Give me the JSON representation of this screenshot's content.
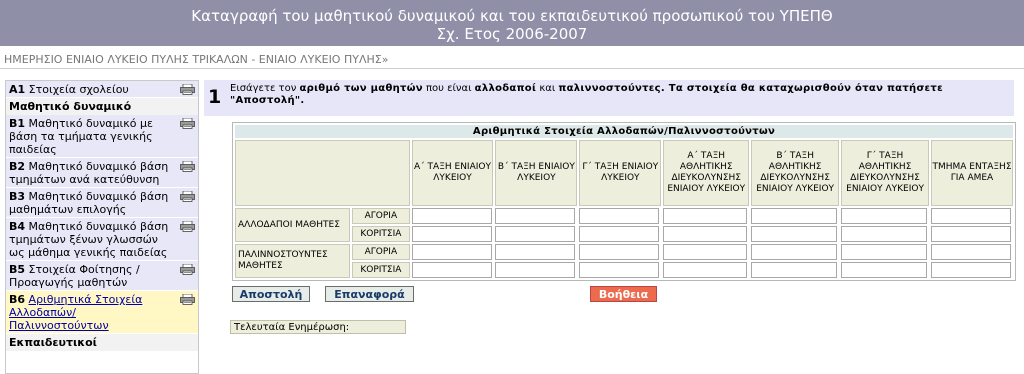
{
  "header": {
    "title_line1": "Καταγραφή του μαθητικού δυναμικού και του εκπαιδευτικού προσωπικού του ΥΠΕΠΘ",
    "title_line2": "Σχ. Ετος 2006-2007"
  },
  "breadcrumb": "ΗΜΕΡΗΣΙΟ ΕΝΙΑΙΟ ΛΥΚΕΙΟ ΠΥΛΗΣ ΤΡΙΚΑΛΩΝ - ΕΝΙΑΙΟ ΛΥΚΕΙΟ ΠΥΛΗΣ»",
  "sidebar": {
    "items": [
      {
        "num": "A1",
        "label": "Στοιχεία σχολείου"
      },
      {
        "section": "Μαθητικό δυναμικό"
      },
      {
        "num": "B1",
        "label": "Μαθητικό δυναμικό με βάση τα τμήματα γενικής παιδείας"
      },
      {
        "num": "B2",
        "label": "Μαθητικό δυναμικό βάση τμημάτων ανά κατεύθυνση"
      },
      {
        "num": "B3",
        "label": "Μαθητικό δυναμικό βάση μαθημάτων επιλογής"
      },
      {
        "num": "B4",
        "label": "Μαθητικό δυναμικό βάση τμημάτων ξένων γλωσσών ως μάθημα γενικής παιδείας"
      },
      {
        "num": "B5",
        "label": "Στοιχεία Φοίτησης / Προαγωγής μαθητών"
      },
      {
        "num": "B6",
        "label": "Αριθμητικά Στοιχεία Αλλοδαπών/ Παλιννοστούντων"
      },
      {
        "section": "Εκπαιδευτικοί"
      }
    ]
  },
  "instructions": {
    "step": "1",
    "text_1": "Εισάγετε τον ",
    "bold_1": "αριθμό των μαθητών",
    "text_2": " που είναι ",
    "bold_2": "αλλοδαποί",
    "text_3": " και ",
    "bold_3": "παλιννοστούντες. Τα στοιχεία θα καταχωρισθούν όταν πατήσετε \"Αποστολή\"."
  },
  "table": {
    "caption": "Αριθμητικά Στοιχεία Αλλοδαπών/Παλιννοστούντων",
    "columns": [
      "Α΄ ΤΑΞΗ ΕΝΙΑΙΟΥ ΛΥΚΕΙΟΥ",
      "Β΄ ΤΑΞΗ ΕΝΙΑΙΟΥ ΛΥΚΕΙΟΥ",
      "Γ΄ ΤΑΞΗ ΕΝΙΑΙΟΥ ΛΥΚΕΙΟΥ",
      "Α΄ ΤΑΞΗ ΑΘΛΗΤΙΚΗΣ ΔΙΕΥΚΟΛΥΝΣΗΣ ΕΝΙΑΙΟΥ ΛΥΚΕΙΟΥ",
      "Β΄ ΤΑΞΗ ΑΘΛΗΤΙΚΗΣ ΔΙΕΥΚΟΛΥΝΣΗΣ ΕΝΙΑΙΟΥ ΛΥΚΕΙΟΥ",
      "Γ΄ ΤΑΞΗ ΑΘΛΗΤΙΚΗΣ ΔΙΕΥΚΟΛΥΝΣΗΣ ΕΝΙΑΙΟΥ ΛΥΚΕΙΟΥ",
      "ΤΜΗΜΑ ΕΝΤΑΞΗΣ ΓΙΑ ΑΜΕΑ"
    ],
    "groups": [
      {
        "label": "ΑΛΛΟΔΑΠΟΙ ΜΑΘΗΤΕΣ",
        "rows": [
          "ΑΓΟΡΙΑ",
          "ΚΟΡΙΤΣΙΑ"
        ]
      },
      {
        "label": "ΠΑΛΙΝΝΟΣΤΟΥΝΤΕΣ ΜΑΘΗΤΕΣ",
        "rows": [
          "ΑΓΟΡΙΑ",
          "ΚΟΡΙΤΣΙΑ"
        ]
      }
    ]
  },
  "buttons": {
    "send": "Αποστολή",
    "reset": "Επαναφορά",
    "help": "Βοήθεια"
  },
  "last_update_label": "Τελευταία Ενημέρωση:",
  "colors": {
    "header_bg": "#8f8fa8",
    "sidebar_item_bg": "#e7e7f8",
    "active_item_bg": "#fff7c4",
    "help_button_bg": "#ec6a4e"
  }
}
